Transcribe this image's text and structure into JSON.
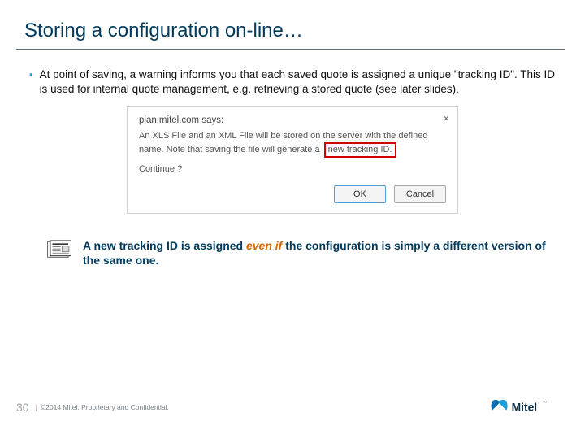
{
  "title": "Storing a configuration on-line…",
  "bullet": {
    "marker": "•",
    "text": "At point of saving, a warning informs you that each saved quote is assigned a unique \"tracking ID\". This ID is used for internal quote management, e.g. retrieving a stored quote (see later slides)."
  },
  "dialog": {
    "host": "plan.mitel.com says:",
    "msg_pre": "An XLS File and an XML File will be stored on the server with the defined name. Note that saving the file will generate a",
    "msg_highlight": "new tracking ID.",
    "continue": "Continue ?",
    "ok": "OK",
    "cancel": "Cancel"
  },
  "note": {
    "pre": "A new tracking ID is assigned ",
    "em": "even if",
    "post": " the configuration is simply a different version of the same one."
  },
  "footer": {
    "page": "30",
    "sep": "|",
    "copyright": "©2014 Mitel. Proprietary and Confidential.",
    "logo_text": "Mitel"
  }
}
